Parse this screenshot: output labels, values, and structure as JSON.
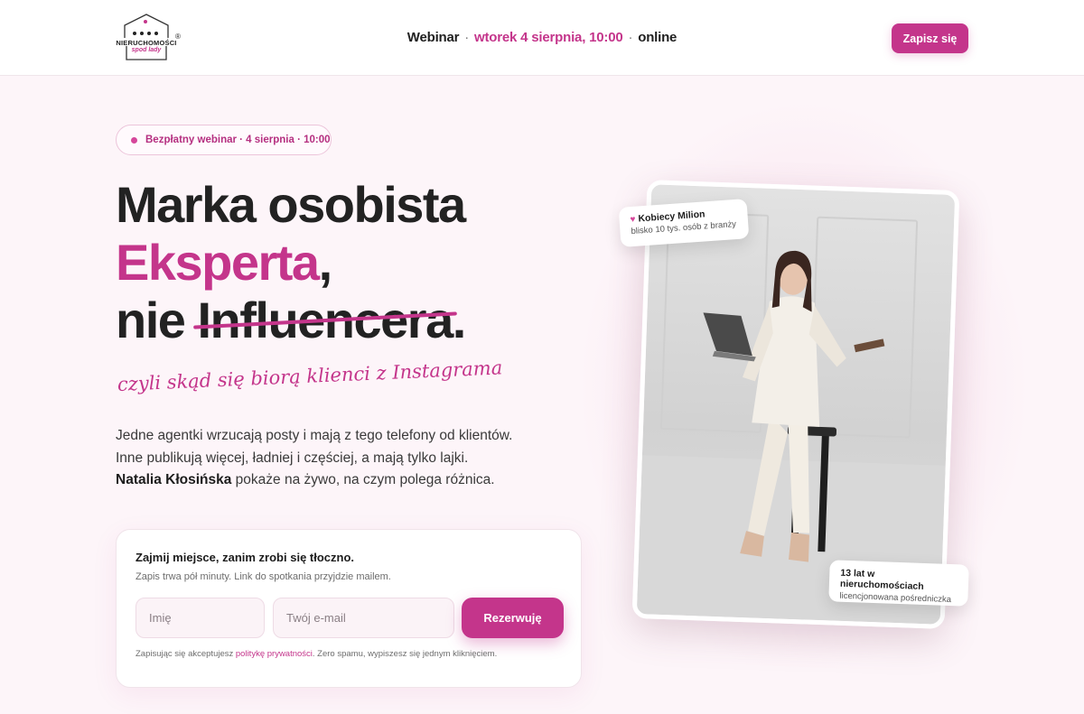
{
  "header": {
    "logo_text": "NIERUCHOMOŚCI",
    "logo_sub": "spod lady",
    "logo_reg": "®",
    "webinar_label": "Webinar",
    "webinar_date": "wtorek 4 sierpnia, 10:00",
    "webinar_mode": "online",
    "signup_button": "Zapisz się"
  },
  "hero": {
    "badge": "Bezpłatny webinar · 4 sierpnia · 10:00",
    "headline_line1": "Marka osobista",
    "headline_line2": "Eksperta",
    "headline_line2_suffix": ",",
    "headline_line3_prefix": "nie ",
    "headline_line3_strike": "Influencera",
    "headline_line3_suffix": ".",
    "script_line": "czyli skąd się biorą klienci z Instagrama",
    "para_line1": "Jedne agentki wrzucają posty i mają z tego telefony od klientów.",
    "para_line2": "Inne publikują więcej, ładniej i częściej, a mają tylko lajki.",
    "para_name": "Natalia Kłosińska",
    "para_line3_rest": " pokaże na żywo, na czym polega różnica."
  },
  "form": {
    "title": "Zajmij miejsce, zanim zrobi się tłoczno.",
    "subtitle": "Zapis trwa pół minuty. Link do spotkania przyjdzie mailem.",
    "name_placeholder": "Imię",
    "email_placeholder": "Twój e-mail",
    "submit": "Rezerwuję",
    "legal_prefix": "Zapisując się akceptujesz ",
    "legal_link": "politykę prywatności",
    "legal_suffix": ". Zero spamu, wypiszesz się jednym kliknięciem."
  },
  "photo_cards": {
    "card1_title": "Kobiecy Milion",
    "card1_sub": "blisko 10 tys. osób z branży",
    "card2_title": "13 lat w nieruchomościach",
    "card2_sub": "licencjonowana pośredniczka"
  },
  "colors": {
    "accent": "#c4358b",
    "text": "#222222",
    "background": "#fdf5f9"
  }
}
